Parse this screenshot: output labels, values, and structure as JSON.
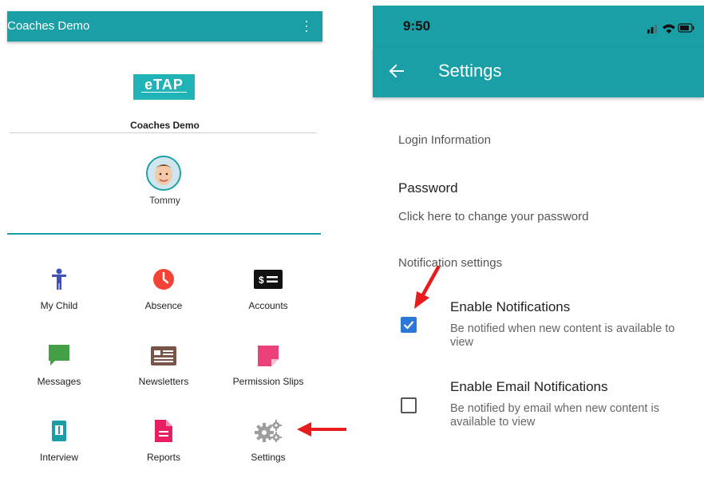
{
  "left_screen": {
    "app_title": "Coaches Demo",
    "logo_text": "eTAP",
    "school_name": "Coaches Demo",
    "child_name": "Tommy",
    "tiles": [
      {
        "label": "My Child",
        "icon": "person-icon",
        "color": "#3f51b5"
      },
      {
        "label": "Absence",
        "icon": "clock-icon",
        "color": "#f44336"
      },
      {
        "label": "Accounts",
        "icon": "money-icon",
        "color": "#111111"
      },
      {
        "label": "Messages",
        "icon": "chat-icon",
        "color": "#43a047"
      },
      {
        "label": "Newsletters",
        "icon": "newspaper-icon",
        "color": "#795548"
      },
      {
        "label": "Permission Slips",
        "icon": "note-icon",
        "color": "#ec407a"
      },
      {
        "label": "Interview",
        "icon": "phone-icon",
        "color": "#1a9fa6"
      },
      {
        "label": "Reports",
        "icon": "document-icon",
        "color": "#e91e63"
      },
      {
        "label": "Settings",
        "icon": "gears-icon",
        "color": "#9e9e9e"
      }
    ]
  },
  "right_screen": {
    "status_time": "9:50",
    "title": "Settings",
    "login_section": "Login Information",
    "password_title": "Password",
    "password_subtitle": "Click here to change your password",
    "notification_section": "Notification settings",
    "enable_notifications": {
      "title": "Enable Notifications",
      "subtitle": "Be notified when new content is available to view",
      "checked": true
    },
    "enable_email_notifications": {
      "title": "Enable Email Notifications",
      "subtitle": "Be notified by email when new content is available to view",
      "checked": false
    }
  },
  "colors": {
    "teal": "#1a9fa6",
    "checkbox_blue": "#2b78d8",
    "annotation_red": "#e81c1c"
  }
}
